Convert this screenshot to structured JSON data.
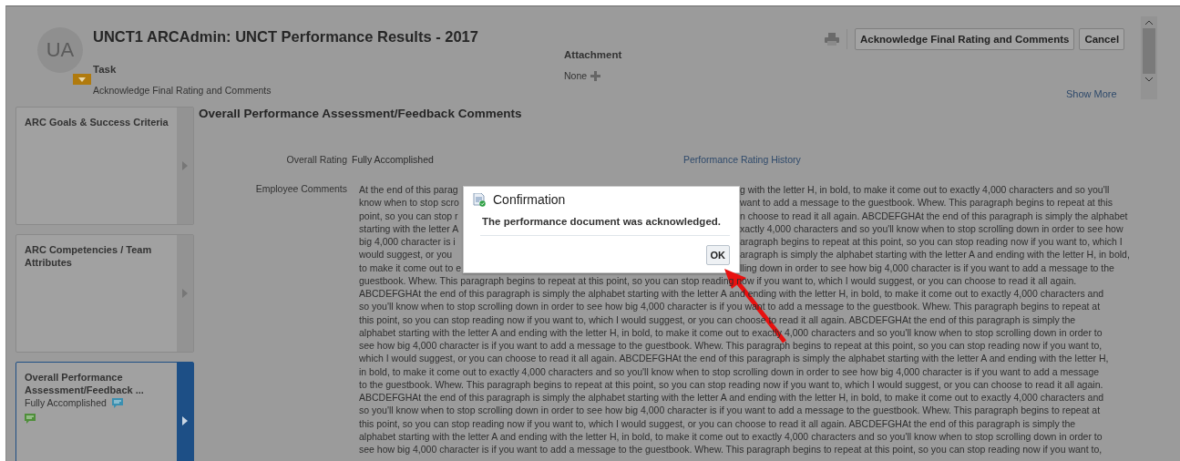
{
  "header": {
    "avatar_initials": "UA",
    "title": "UNCT1 ARCAdmin: UNCT Performance Results - 2017",
    "task_label": "Task",
    "task_value": "Acknowledge Final Rating and Comments",
    "attachment_label": "Attachment",
    "attachment_value": "None",
    "show_more": "Show More"
  },
  "actions": {
    "primary": "Acknowledge Final Rating and Comments",
    "cancel": "Cancel"
  },
  "sidebar": {
    "items": [
      {
        "title": "ARC Goals & Success Criteria",
        "selected": false
      },
      {
        "title": "ARC Competencies / Team Attributes",
        "selected": false
      },
      {
        "title": "Overall Performance Assessment/Feedback ...",
        "subtitle": "Fully Accomplished",
        "selected": true
      }
    ]
  },
  "section": {
    "title": "Overall Performance Assessment/Feedback Comments",
    "rating_label": "Overall Rating",
    "rating_value": "Fully Accomplished",
    "history_link": "Performance Rating History",
    "comments_label": "Employee Comments",
    "comment_lines": [
      {
        "left": "At the end of this parag",
        "right": "g with the letter H, in bold, to make it come out to exactly 4,000 characters and so you'll"
      },
      {
        "left": "know when to stop scro",
        "right": "want to add a message to the guestbook. Whew. This paragraph begins to repeat at this"
      },
      {
        "left": "point, so you can stop r",
        "right": "n choose to read it all again. ABCDEFGHAt the end of this paragraph is simply the alphabet"
      },
      {
        "left": "starting with the letter A",
        "right": "xactly 4,000 characters and so you'll know when to stop scrolling down in order to see how"
      },
      {
        "left": "big 4,000 character is i",
        "right": "aragraph begins to repeat at this point, so you can stop reading now if you want to, which I"
      },
      {
        "left": "would suggest, or you",
        "right": "aragraph is simply the alphabet starting with the letter A and ending with the letter H, in bold,"
      },
      {
        "left": "to make it come out to e",
        "right": "lling down in order to see how big 4,000 character is if you want to add a message to the"
      },
      {
        "text": "guestbook. Whew. This paragraph begins to repeat at this point, so you can stop reading now if you want to, which I would suggest, or you can choose to read it all again."
      },
      {
        "text": "ABCDEFGHAt the end of this paragraph is simply the alphabet starting with the letter A and ending with the letter H, in bold, to make it come out to exactly 4,000 characters and"
      },
      {
        "text": "so you'll know when to stop scrolling down in order to see how big 4,000 character is if you want to add a message to the guestbook. Whew. This paragraph begins to repeat at"
      },
      {
        "text": "this point, so you can stop reading now if you want to, which I would suggest, or you can choose to read it all again. ABCDEFGHAt the end of this paragraph is simply the"
      },
      {
        "text": "alphabet starting with the letter A and ending with the letter H, in bold, to make it come out to exactly 4,000 characters and so you'll know when to stop scrolling down in order to"
      },
      {
        "text": "see how big 4,000 character is if you want to add a message to the guestbook. Whew. This paragraph begins to repeat at this point, so you can stop reading now if you want to,"
      },
      {
        "text": "which I would suggest, or you can choose to read it all again. ABCDEFGHAt the end of this paragraph is simply the alphabet starting with the letter A and ending with the letter H,"
      },
      {
        "text": "in bold, to make it come out to exactly 4,000 characters and so you'll know when to stop scrolling down in order to see how big 4,000 character is if you want to add a message"
      },
      {
        "text": "to the guestbook. Whew. This paragraph begins to repeat at this point, so you can stop reading now if you want to, which I would suggest, or you can choose to read it all again."
      },
      {
        "text": "ABCDEFGHAt the end of this paragraph is simply the alphabet starting with the letter A and ending with the letter H, in bold, to make it come out to exactly 4,000 characters and"
      },
      {
        "text": "so you'll know when to stop scrolling down in order to see how big 4,000 character is if you want to add a message to the guestbook. Whew. This paragraph begins to repeat at"
      },
      {
        "text": "this point, so you can stop reading now if you want to, which I would suggest, or you can choose to read it all again. ABCDEFGHAt the end of this paragraph is simply the"
      },
      {
        "text": "alphabet starting with the letter A and ending with the letter H, in bold, to make it come out to exactly 4,000 characters and so you'll know when to stop scrolling down in order to"
      },
      {
        "text": "see how big 4,000 character is if you want to add a message to the guestbook. Whew. This paragraph begins to repeat at this point, so you can stop reading now if you want to,"
      }
    ]
  },
  "dialog": {
    "title": "Confirmation",
    "message": "The performance document was acknowledged.",
    "ok": "OK"
  }
}
